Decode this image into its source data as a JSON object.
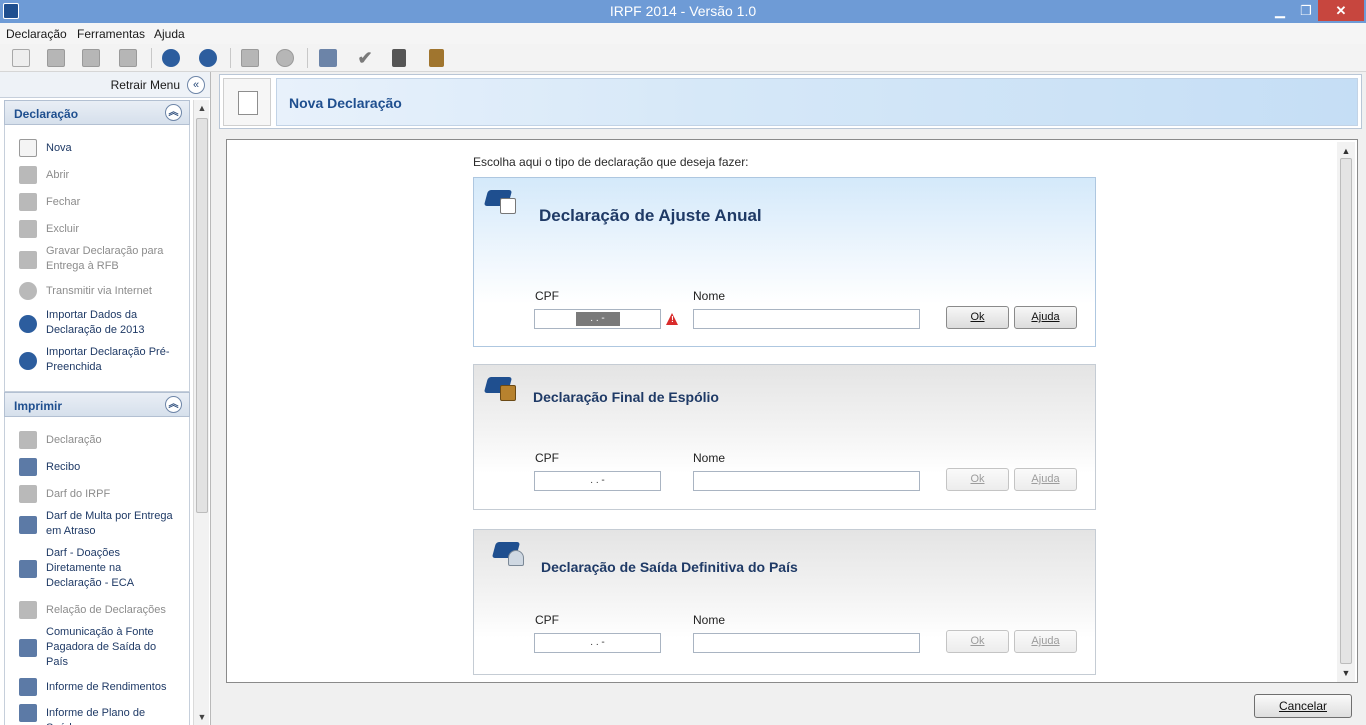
{
  "window": {
    "title": "IRPF 2014 - Versão 1.0",
    "min_glyph": "▁",
    "max_glyph": "❐",
    "close_glyph": "✕"
  },
  "menu": [
    "Declaração",
    "Ferramentas",
    "Ajuda"
  ],
  "left": {
    "retract_label": "Retrair Menu",
    "retract_glyph": "«",
    "sections": [
      {
        "title": "Declaração",
        "items": [
          {
            "label": "Nova",
            "icon": "new-doc-icon",
            "enabled": true
          },
          {
            "label": "Abrir",
            "icon": "open-icon",
            "enabled": false
          },
          {
            "label": "Fechar",
            "icon": "folder-icon",
            "enabled": false
          },
          {
            "label": "Excluir",
            "icon": "trash-icon",
            "enabled": false
          },
          {
            "label": "Gravar Declaração para Entrega à RFB",
            "icon": "save-icon",
            "enabled": false
          },
          {
            "label": "Transmitir via Internet",
            "icon": "globe-icon",
            "enabled": false
          },
          {
            "label": "Importar Dados da Declaração de 2013",
            "icon": "import-icon",
            "enabled": true
          },
          {
            "label": "Importar Declaração Pré-Preenchida",
            "icon": "import-prefilled-icon",
            "enabled": true
          }
        ]
      },
      {
        "title": "Imprimir",
        "items": [
          {
            "label": "Declaração",
            "icon": "printer-icon",
            "enabled": false
          },
          {
            "label": "Recibo",
            "icon": "printer-icon",
            "enabled": true
          },
          {
            "label": "Darf do IRPF",
            "icon": "printer-icon",
            "enabled": false
          },
          {
            "label": "Darf de Multa por Entrega em Atraso",
            "icon": "printer-icon",
            "enabled": true
          },
          {
            "label": "Darf - Doações Diretamente na Declaração - ECA",
            "icon": "printer-icon",
            "enabled": true
          },
          {
            "label": "Relação de Declarações",
            "icon": "printer-icon",
            "enabled": false
          },
          {
            "label": "Comunicação à Fonte Pagadora de Saída do País",
            "icon": "printer-icon",
            "enabled": true
          },
          {
            "label": "Informe de Rendimentos",
            "icon": "printer-icon",
            "enabled": true
          },
          {
            "label": "Informe de Plano de Saúde",
            "icon": "printer-icon",
            "enabled": true
          }
        ]
      }
    ]
  },
  "header": {
    "title": "Nova Declaração"
  },
  "main": {
    "prompt": "Escolha aqui o tipo de declaração que deseja fazer:",
    "cards": [
      {
        "title": "Declaração de Ajuste Anual",
        "cpf_label": "CPF",
        "nome_label": "Nome",
        "cpf_value": ". . -",
        "nome_value": "",
        "ok": "Ok",
        "help": "Ajuda",
        "active": true
      },
      {
        "title": "Declaração Final de Espólio",
        "cpf_label": "CPF",
        "nome_label": "Nome",
        "cpf_value": ". . -",
        "nome_value": "",
        "ok": "Ok",
        "help": "Ajuda",
        "active": false
      },
      {
        "title": "Declaração de Saída Definitiva do País",
        "cpf_label": "CPF",
        "nome_label": "Nome",
        "cpf_value": ". . -",
        "nome_value": "",
        "ok": "Ok",
        "help": "Ajuda",
        "active": false
      }
    ],
    "cancel": "Cancelar"
  },
  "colors": {
    "titlebar": "#6e9bd6",
    "accent": "#1f4f8f",
    "close": "#c7463e",
    "warning": "#d92b2b"
  }
}
